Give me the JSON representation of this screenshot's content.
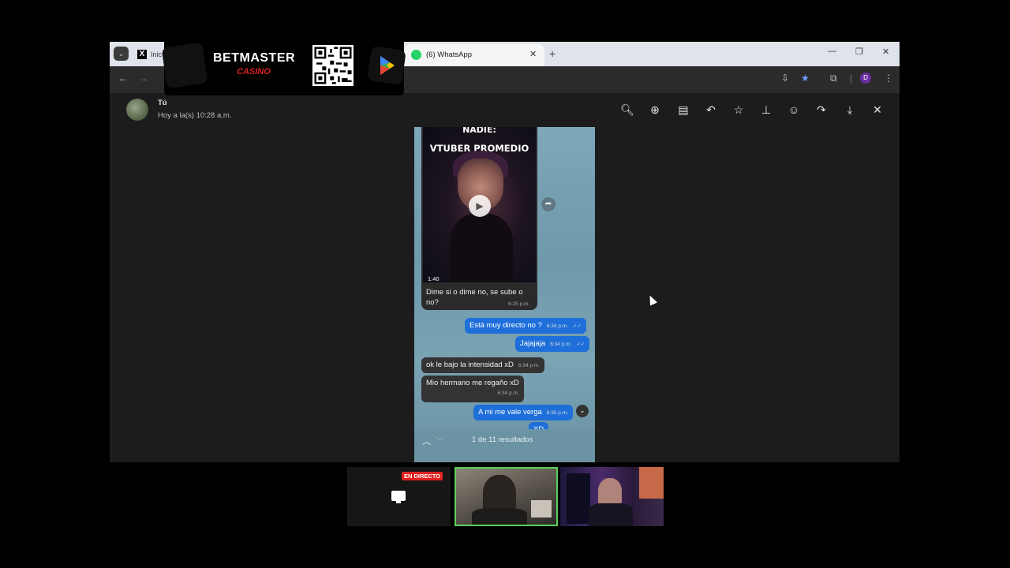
{
  "browser": {
    "tabs": [
      {
        "title": "Inic",
        "icon": "x-logo-icon"
      },
      {
        "title": "(6) WhatsApp",
        "icon": "whatsapp-icon"
      }
    ],
    "profile_initial": "D"
  },
  "viewer": {
    "sender": "Tú",
    "timestamp": "Hoy a la(s) 10:28 a.m.",
    "toolbar_icons": [
      "zoom-out-icon",
      "zoom-in-icon",
      "caption-icon",
      "reply-icon",
      "star-icon",
      "pin-icon",
      "emoji-icon",
      "forward-icon",
      "download-icon",
      "close-icon"
    ]
  },
  "chat": {
    "video": {
      "meme_top": "NADIE:",
      "meme_title": "VTUBER PROMEDIO",
      "duration": "1:40",
      "caption": "Dime si o dime no, se sube o no?",
      "caption_time": "6:25 p.m."
    },
    "messages": [
      {
        "dir": "out",
        "text": "Está muy directo no ?",
        "time": "6:34 p.m."
      },
      {
        "dir": "out",
        "text": "Jajajaja",
        "time": "6:34 p.m."
      },
      {
        "dir": "in",
        "text": "ok le bajo la intensidad xD",
        "time": "6:34 p.m."
      },
      {
        "dir": "in",
        "text": "Mio hermano me regaño xD",
        "time": "6:34 p.m."
      },
      {
        "dir": "out",
        "text": "A mi me vale verga",
        "time": "6:35 p.m."
      },
      {
        "dir": "out",
        "text": "XD",
        "time": ""
      }
    ],
    "search_results": "1 de 11 resultados"
  },
  "ad": {
    "brand": "BETMASTER",
    "sub": "CASINO"
  },
  "stream": {
    "live_badge": "EN DIRECTO"
  }
}
